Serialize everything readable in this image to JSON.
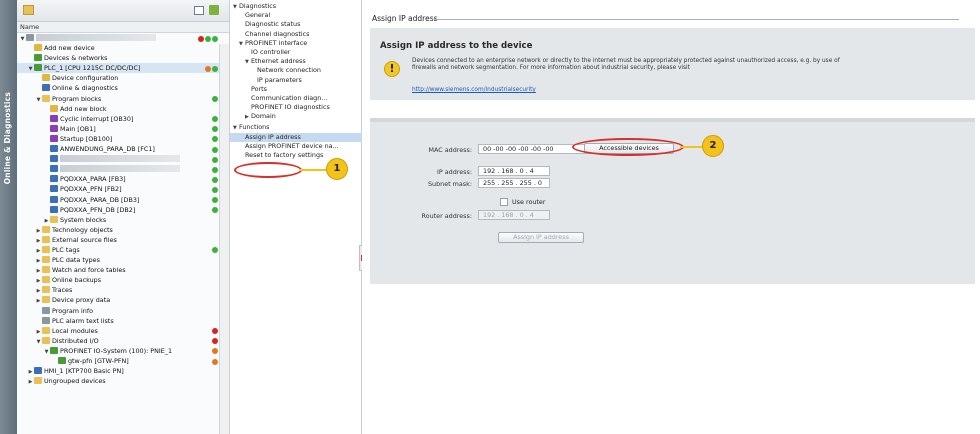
{
  "sidetab": {
    "label": "Online & Diagnostics"
  },
  "tree": {
    "header": "Name",
    "rows": [
      {
        "label": "",
        "level": 0,
        "tw": "▼",
        "icon": "gray",
        "blur": true,
        "status": [
          "r",
          "g",
          "g"
        ]
      },
      {
        "label": "Add new device",
        "level": 1,
        "tw": "",
        "icon": "yellow"
      },
      {
        "label": "Devices & networks",
        "level": 1,
        "tw": "",
        "icon": "green"
      },
      {
        "label": "PLC_1 [CPU 1215C DC/DC/DC]",
        "level": 1,
        "tw": "▼",
        "icon": "green",
        "sel": true,
        "status": [
          "o",
          "g"
        ]
      },
      {
        "label": "Device configuration",
        "level": 2,
        "tw": "",
        "icon": "yellow"
      },
      {
        "label": "Online & diagnostics",
        "level": 2,
        "tw": "",
        "icon": "blue"
      },
      {
        "label": "Program blocks",
        "level": 2,
        "tw": "▼",
        "icon": "folder",
        "status": [
          "g"
        ]
      },
      {
        "label": "Add new block",
        "level": 3,
        "tw": "",
        "icon": "yellow"
      },
      {
        "label": "Cyclic interrupt [OB30]",
        "level": 3,
        "tw": "",
        "icon": "purple",
        "status": [
          "g"
        ]
      },
      {
        "label": "Main [OB1]",
        "level": 3,
        "tw": "",
        "icon": "purple",
        "status": [
          "g"
        ]
      },
      {
        "label": "Startup [OB100]",
        "level": 3,
        "tw": "",
        "icon": "purple",
        "status": [
          "g"
        ]
      },
      {
        "label": "ANWENDUNG_PARA_DB [FC1]",
        "level": 3,
        "tw": "",
        "icon": "blue",
        "status": [
          "g"
        ]
      },
      {
        "label": "",
        "level": 3,
        "tw": "",
        "icon": "blue",
        "blur": true,
        "status": [
          "g"
        ]
      },
      {
        "label": "",
        "level": 3,
        "tw": "",
        "icon": "blue",
        "blur": true,
        "status": [
          "g"
        ]
      },
      {
        "label": "PQDXXA_PARA [FB3]",
        "level": 3,
        "tw": "",
        "icon": "blue",
        "status": [
          "g"
        ]
      },
      {
        "label": "PQDXXA_PFN [FB2]",
        "level": 3,
        "tw": "",
        "icon": "blue",
        "status": [
          "g"
        ]
      },
      {
        "label": "PQDXXA_PARA_DB [DB3]",
        "level": 3,
        "tw": "",
        "icon": "blue",
        "status": [
          "g"
        ]
      },
      {
        "label": "PQDXXA_PFN_DB [DB2]",
        "level": 3,
        "tw": "",
        "icon": "blue",
        "status": [
          "g"
        ]
      },
      {
        "label": "System blocks",
        "level": 3,
        "tw": "▶",
        "icon": "folder"
      },
      {
        "label": "Technology objects",
        "level": 2,
        "tw": "▶",
        "icon": "folder"
      },
      {
        "label": "External source files",
        "level": 2,
        "tw": "▶",
        "icon": "folder"
      },
      {
        "label": "PLC tags",
        "level": 2,
        "tw": "▶",
        "icon": "folder",
        "status": [
          "g"
        ]
      },
      {
        "label": "PLC data types",
        "level": 2,
        "tw": "▶",
        "icon": "folder"
      },
      {
        "label": "Watch and force tables",
        "level": 2,
        "tw": "▶",
        "icon": "folder"
      },
      {
        "label": "Online backups",
        "level": 2,
        "tw": "▶",
        "icon": "folder"
      },
      {
        "label": "Traces",
        "level": 2,
        "tw": "▶",
        "icon": "folder"
      },
      {
        "label": "Device proxy data",
        "level": 2,
        "tw": "▶",
        "icon": "folder"
      },
      {
        "label": "Program info",
        "level": 2,
        "tw": "",
        "icon": "gray"
      },
      {
        "label": "PLC alarm text lists",
        "level": 2,
        "tw": "",
        "icon": "gray"
      },
      {
        "label": "Local modules",
        "level": 2,
        "tw": "▶",
        "icon": "folder",
        "status": [
          "r"
        ]
      },
      {
        "label": "Distributed I/O",
        "level": 2,
        "tw": "▼",
        "icon": "folder",
        "status": [
          "r"
        ]
      },
      {
        "label": "PROFINET IO-System (100): PNIE_1",
        "level": 3,
        "tw": "▼",
        "icon": "green",
        "status": [
          "o"
        ]
      },
      {
        "label": "gtw-pfn [GTW-PFN]",
        "level": 4,
        "tw": "",
        "icon": "green",
        "status": [
          "o"
        ]
      },
      {
        "label": "HMI_1 [KTP700 Basic PN]",
        "level": 1,
        "tw": "▶",
        "icon": "blue"
      },
      {
        "label": "Ungrouped devices",
        "level": 1,
        "tw": "▶",
        "icon": "folder"
      }
    ]
  },
  "tasks": {
    "rows": [
      {
        "label": "Diagnostics",
        "level": 0,
        "tw": "▼"
      },
      {
        "label": "General",
        "level": 1,
        "tw": ""
      },
      {
        "label": "Diagnostic status",
        "level": 1,
        "tw": ""
      },
      {
        "label": "Channel diagnostics",
        "level": 1,
        "tw": ""
      },
      {
        "label": "PROFINET interface",
        "level": 1,
        "tw": "▼"
      },
      {
        "label": "IO controller",
        "level": 2,
        "tw": ""
      },
      {
        "label": "Ethernet address",
        "level": 2,
        "tw": "▼"
      },
      {
        "label": "Network connection",
        "level": 3,
        "tw": ""
      },
      {
        "label": "IP parameters",
        "level": 3,
        "tw": ""
      },
      {
        "label": "Ports",
        "level": 2,
        "tw": ""
      },
      {
        "label": "Communication diagn...",
        "level": 2,
        "tw": ""
      },
      {
        "label": "PROFINET IO diagnostics",
        "level": 2,
        "tw": ""
      },
      {
        "label": "Domain",
        "level": 2,
        "tw": "▶"
      },
      {
        "label": "Functions",
        "level": 0,
        "tw": "▼"
      },
      {
        "label": "Assign IP address",
        "level": 1,
        "tw": "",
        "sel": true
      },
      {
        "label": "Assign PROFINET device na...",
        "level": 1,
        "tw": ""
      },
      {
        "label": "Reset to factory settings",
        "level": 1,
        "tw": ""
      }
    ]
  },
  "main": {
    "section_title": "Assign IP address",
    "warn_title": "Assign IP address to the device",
    "warn_text": "Devices connected to an enterprise network or directly to the internet must be appropriately protected against unauthorized access, e.g. by use of firewalls and network segmentation. For more information about industrial security, please visit",
    "warn_link": "http://www.siemens.com/industrialsecurity",
    "mac_label": "MAC address:",
    "mac_value": "00 -00 -00 -00 -00 -00",
    "accessible_btn": "Accessible devices",
    "ip_label": "IP address:",
    "ip_value": "192 . 168 . 0 . 4",
    "subnet_label": "Subnet mask:",
    "subnet_value": "255 . 255 . 255 . 0",
    "use_router_label": "Use router",
    "router_label": "Router address:",
    "router_value": "192 . 168 . 0 . 4",
    "assign_btn": "Assign IP address"
  },
  "callouts": {
    "one": "1",
    "two": "2"
  }
}
